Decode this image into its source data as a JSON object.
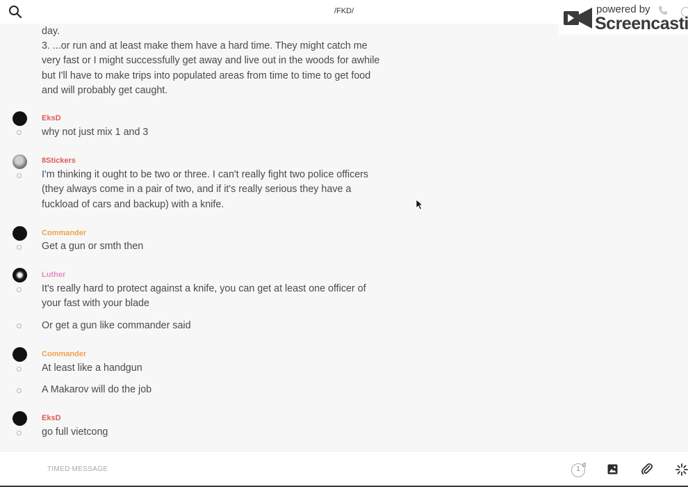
{
  "header": {
    "channel_title": "/FKD/"
  },
  "watermark": {
    "powered_by": "powered by",
    "brand": "Screencastify"
  },
  "colors": {
    "author_red": "#e05a5a",
    "author_orange": "#f0a34a",
    "author_pink": "#e58bc4"
  },
  "messages": [
    {
      "lines": [
        "day.",
        "3. ...or run and at least make them have a hard time. They might catch me very fast or I might successfully get away and live out in the woods for awhile but I'll have to make trips into populated areas from time to time to get food and will probably get caught."
      ]
    },
    {
      "author": "EksD",
      "text": "why not just mix 1 and 3"
    },
    {
      "author": "8Stickers",
      "text": "I'm thinking it ought to be two or three. I can't really fight two police officers (they always come in a pair of two, and if it's really serious they have a fuckload of cars and backup) with a knife."
    },
    {
      "author": "Commander",
      "text": "Get a gun or smth then"
    },
    {
      "author": "Luther",
      "text": "It's really hard to protect against a knife, you can get at least one officer of your fast with your blade"
    },
    {
      "text": "Or get a gun like commander said"
    },
    {
      "author": "Commander",
      "text": "At least like a handgun"
    },
    {
      "text": "A Makarov will do the job"
    },
    {
      "author": "EksD",
      "text": "go full vietcong"
    }
  ],
  "composer": {
    "placeholder": "TIMED MESSAGE",
    "timer_value": "1",
    "timer_unit": "d"
  }
}
